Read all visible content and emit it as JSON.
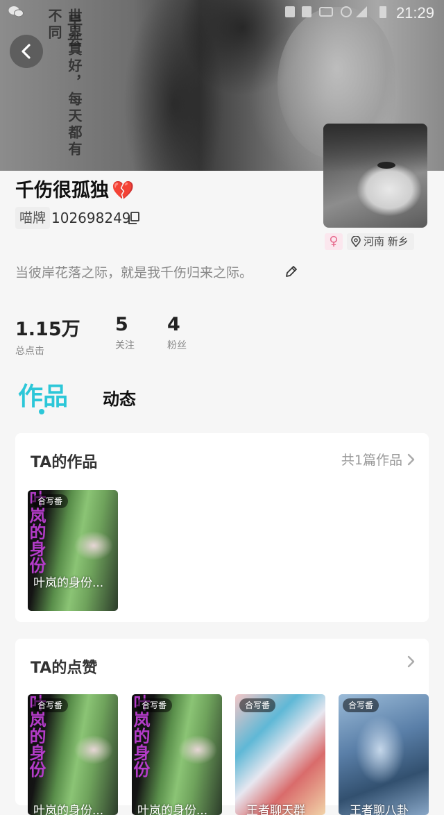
{
  "status_bar": {
    "time": "21:29"
  },
  "profile": {
    "username": "千伤很孤独",
    "heart_emoji": "💔",
    "badge_label": "喵牌",
    "user_id": "102698249",
    "gender_symbol": "♀",
    "location": "河南 新乡",
    "bio": "当彼岸花落之际，就是我千伤归来之际。"
  },
  "stats": [
    {
      "value": "1.15万",
      "label": "总点击"
    },
    {
      "value": "5",
      "label": "关注"
    },
    {
      "value": "4",
      "label": "粉丝"
    }
  ],
  "tabs": {
    "active": "作品",
    "other": "动态"
  },
  "works_section": {
    "title": "TA的作品",
    "more": "共1篇作品",
    "items": [
      {
        "tag": "合写番",
        "caption": "叶岚的身份...",
        "cover_side_text": "叶岚的身份"
      }
    ]
  },
  "likes_section": {
    "title": "TA的点赞",
    "items": [
      {
        "tag": "合写番",
        "caption": "叶岚的身份...",
        "cover_side_text": "叶岚的身份"
      },
      {
        "tag": "合写番",
        "caption": "叶岚的身份...",
        "cover_side_text": "叶岚的身份"
      },
      {
        "tag": "合写番",
        "caption": "王者聊天群"
      },
      {
        "tag": "合写番",
        "caption": "王者聊八卦"
      }
    ]
  },
  "cover_image": {
    "overlay_text_1": "世界真好，每天都有不同",
    "overlay_text_2": "早去"
  },
  "colors": {
    "accent": "#2cc7d8",
    "heart": "#e0579a",
    "gender": "#e66a8d"
  }
}
